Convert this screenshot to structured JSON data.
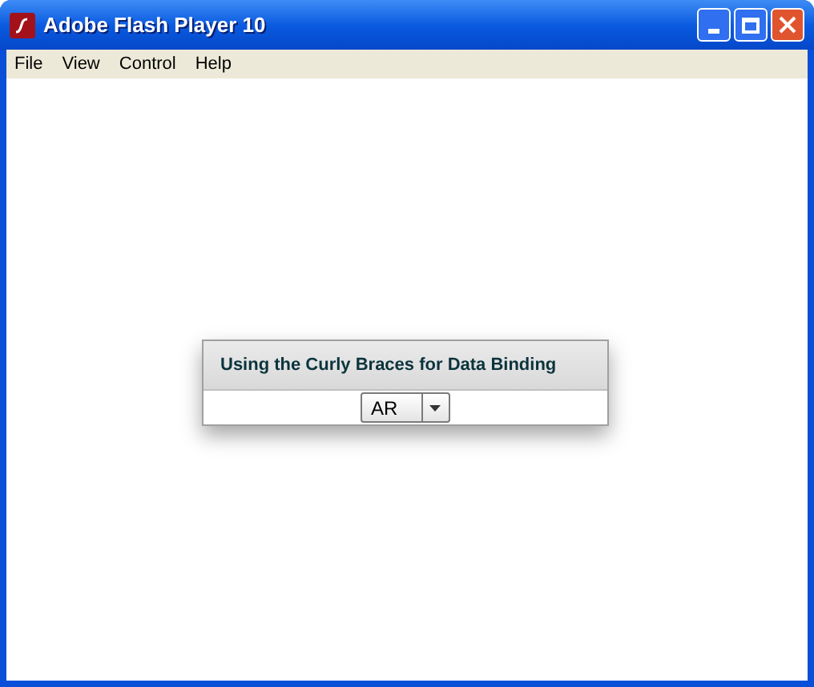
{
  "window": {
    "title": "Adobe Flash Player 10"
  },
  "menu": [
    "File",
    "View",
    "Control",
    "Help"
  ],
  "panel": {
    "title": "Using the Curly Braces for Data Binding",
    "combo": {
      "value": "AR"
    }
  }
}
